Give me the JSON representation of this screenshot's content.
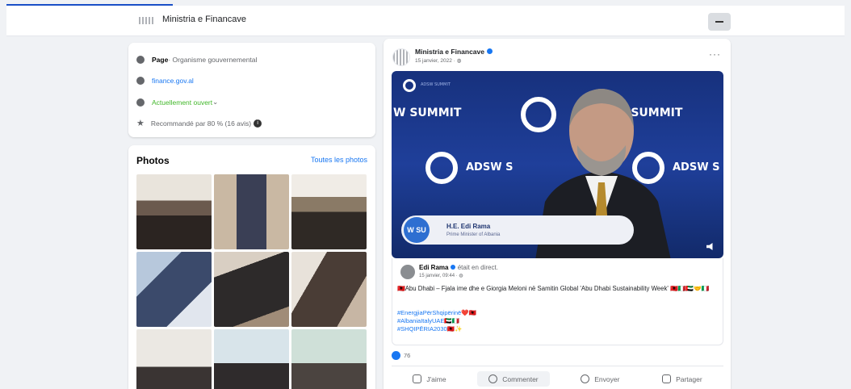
{
  "header": {
    "page_name": "Ministria e Financave"
  },
  "intro": {
    "items": [
      {
        "icon": "info-icon",
        "bold": "Page",
        "text": " · Organisme gouvernemental"
      },
      {
        "icon": "globe-icon",
        "link": "finance.gov.al"
      },
      {
        "icon": "clock-icon",
        "link": "Actuellement ouvert",
        "text": " ⌄"
      },
      {
        "icon": "star-icon",
        "text": "Recommandé par 80 % (16 avis)"
      }
    ]
  },
  "photos": {
    "title": "Photos",
    "see_all": "Toutes les photos"
  },
  "post": {
    "author": "Ministria e Financave",
    "date": "15 janvier, 2022 · ",
    "video": {
      "left_banner": "W SUMMIT",
      "right_banner": "W SUMMIT",
      "logo_small": "ADSW SUMMIT",
      "mid_left": "ADSW S",
      "mid_right": "ADSW S",
      "lower_third_name": "H.E. Edi Rama",
      "lower_third_role": "Prime Minister of Albania",
      "lower_third_badge": "W SU"
    },
    "shared": {
      "name": "Edi Rama",
      "status": " était en direct.",
      "date": "15 janvier, 09:44 · ",
      "message": "🇦🇱Abu Dhabi – Fjala ime dhe e Giorgia Meloni në Samitin Global  'Abu Dhabi Sustainability Week' 🇦🇱🇮🇹🇦🇪🤝🇮🇹",
      "tags": [
        "#EnergjiaPërShqipërinë❤️🇦🇱",
        "#AlbaniaItalyUAE🇦🇪🇮🇹",
        "#SHQIPËRIA2030🇦🇱✨"
      ]
    },
    "reaction_count": "76",
    "actions": [
      "J'aime",
      "Commenter",
      "Envoyer",
      "Partager"
    ]
  }
}
